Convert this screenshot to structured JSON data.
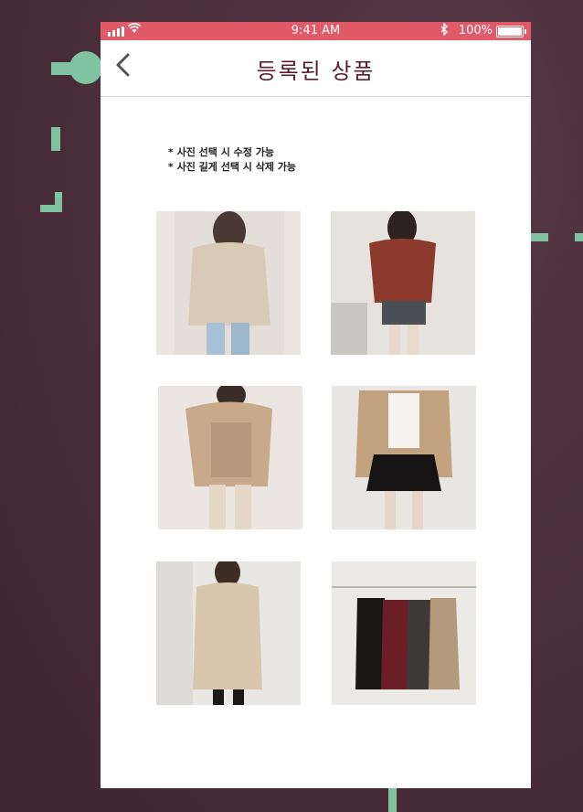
{
  "status_bar": {
    "time": "9:41 AM",
    "battery": "100%",
    "bluetooth_icon": "bluetooth-icon",
    "wifi_icon": "wifi-icon",
    "signal_icon": "signal-icon"
  },
  "header": {
    "title": "등록된 상품",
    "back_icon": "chevron-left-icon"
  },
  "notes": [
    "* 사진 선택 시 수정 가능",
    "* 사진 길게 선택 시 삭제 가능"
  ],
  "products": [
    {
      "name": "beige-knit-sweater-outfit"
    },
    {
      "name": "rust-sweater-denim-skirt-outfit"
    },
    {
      "name": "camel-cardigan-outfit"
    },
    {
      "name": "camel-blazer-black-skirt-outfit"
    },
    {
      "name": "beige-trench-dress-outfit"
    },
    {
      "name": "sleeveless-dresses-on-hangers"
    }
  ],
  "colors": {
    "status_bar": "#e05a67",
    "title": "#5a1e2f",
    "accent_decor": "#7fc3a3",
    "background": "#4d303c"
  }
}
